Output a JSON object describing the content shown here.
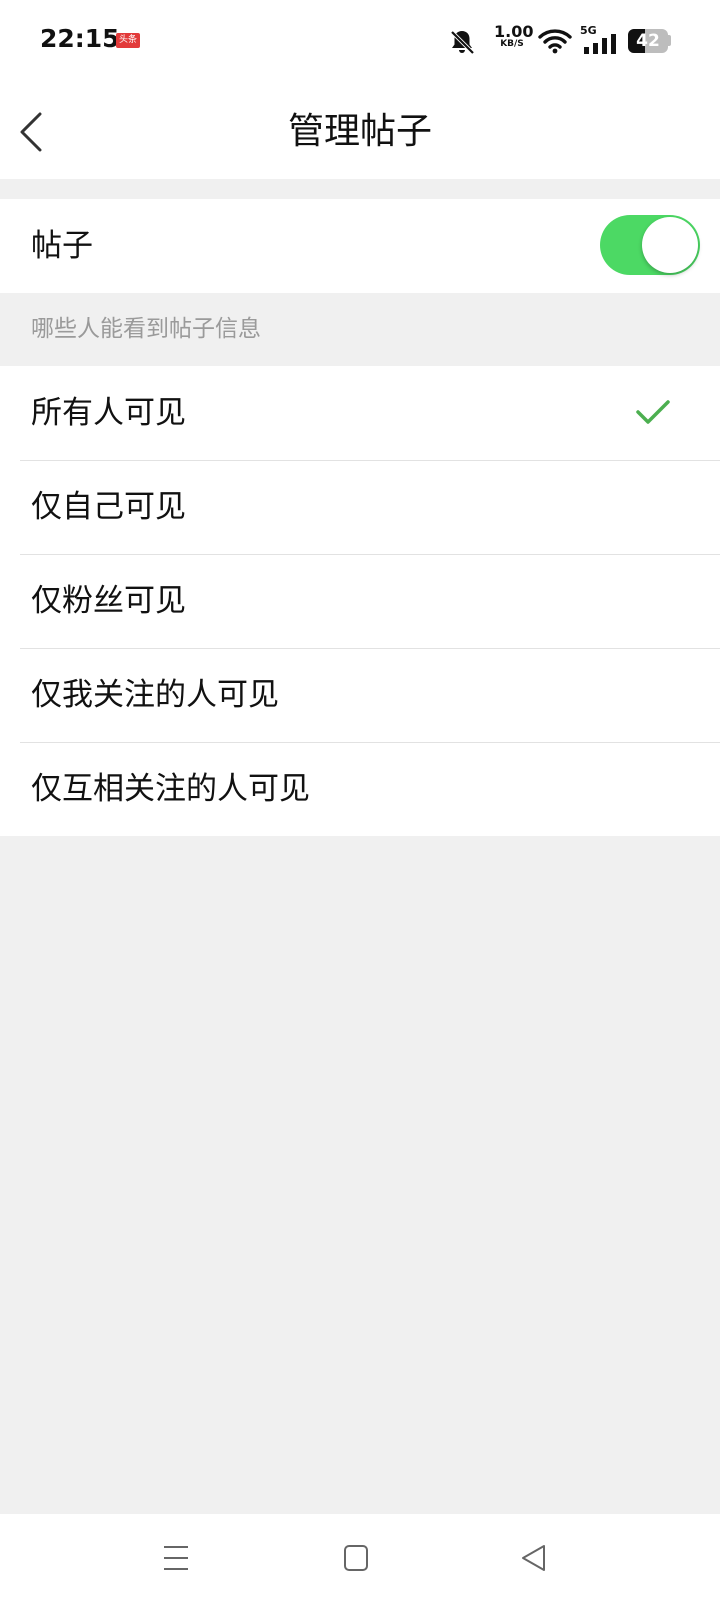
{
  "status_bar": {
    "time": "22:15",
    "app_badge": "头条",
    "net_speed_value": "1.00",
    "net_speed_unit": "KB/S",
    "network_type": "5G",
    "battery_level": "42",
    "icons": [
      "mute-bell-icon",
      "wifi-icon",
      "cellular-signal-icon",
      "battery-icon"
    ]
  },
  "header": {
    "title": "管理帖子",
    "back_icon": "chevron-left-icon"
  },
  "post_toggle": {
    "label": "帖子",
    "enabled": true,
    "accent_color": "#4cd964"
  },
  "visibility": {
    "hint": "哪些人能看到帖子信息",
    "selected_index": 0,
    "check_color": "#4caf50",
    "options": [
      {
        "label": "所有人可见"
      },
      {
        "label": "仅自己可见"
      },
      {
        "label": "仅粉丝可见"
      },
      {
        "label": "仅我关注的人可见"
      },
      {
        "label": "仅互相关注的人可见"
      }
    ]
  },
  "nav_bar": {
    "icons": [
      "menu-icon",
      "home-icon",
      "back-triangle-icon"
    ]
  }
}
